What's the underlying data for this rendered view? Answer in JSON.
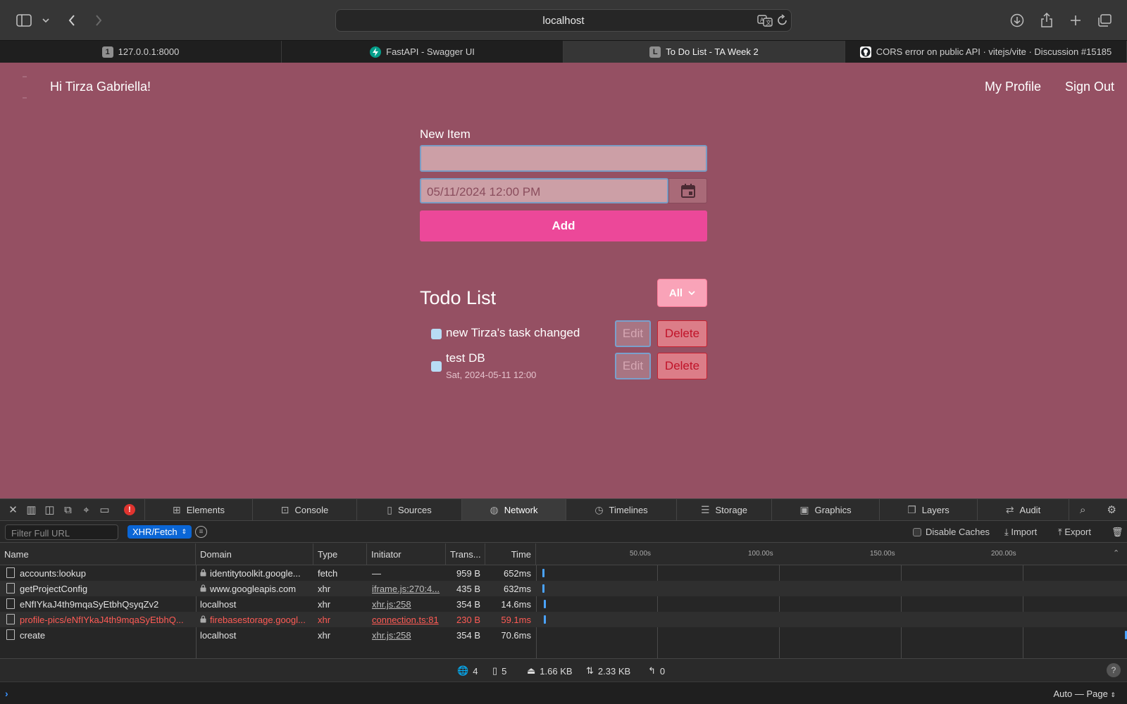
{
  "browser": {
    "url": "localhost",
    "tabs": [
      {
        "favicon": "1",
        "favicon_icon": "number-badge-icon",
        "label": "127.0.0.1:8000",
        "active": false
      },
      {
        "favicon": "",
        "favicon_icon": "fastapi-icon",
        "label": "FastAPI - Swagger UI",
        "active": false
      },
      {
        "favicon": "L",
        "favicon_icon": "letter-badge-icon",
        "label": "To Do List - TA Week 2",
        "active": true
      },
      {
        "favicon": "",
        "favicon_icon": "github-icon",
        "label": "CORS error on public API · vitejs/vite · Discussion #15185",
        "active": false
      }
    ]
  },
  "app": {
    "greeting": "Hi Tirza Gabriella!",
    "nav": {
      "profile": "My Profile",
      "signout": "Sign Out"
    },
    "form": {
      "label": "New Item",
      "item_value": "",
      "date_value": "05/11/2024 12:00 PM",
      "add_label": "Add"
    },
    "list": {
      "title": "Todo List",
      "filter": "All",
      "edit_label": "Edit",
      "delete_label": "Delete",
      "items": [
        {
          "text": "new Tirza's task changed",
          "date": ""
        },
        {
          "text": "test DB",
          "date": "Sat, 2024-05-11 12:00"
        }
      ]
    },
    "colors": {
      "background": "#955063",
      "accent": "#ec4899",
      "filter": "#f9a3b8"
    }
  },
  "devtools": {
    "tabs": [
      "Elements",
      "Console",
      "Sources",
      "Network",
      "Timelines",
      "Storage",
      "Graphics",
      "Layers",
      "Audit"
    ],
    "active_tab": "Network",
    "filter_placeholder": "Filter Full URL",
    "type_filter": "XHR/Fetch",
    "disable_caches": "Disable Caches",
    "import": "Import",
    "export": "Export",
    "columns": [
      "Name",
      "Domain",
      "Type",
      "Initiator",
      "Trans...",
      "Time"
    ],
    "timeline_ticks": [
      "50.00s",
      "100.00s",
      "150.00s",
      "200.00s"
    ],
    "rows": [
      {
        "name": "accounts:lookup",
        "domain": "identitytoolkit.google...",
        "secure": true,
        "type": "fetch",
        "initiator": "—",
        "initiator_link": false,
        "transferred": "959 B",
        "time": "652ms",
        "error": false
      },
      {
        "name": "getProjectConfig",
        "domain": "www.googleapis.com",
        "secure": true,
        "type": "xhr",
        "initiator": "iframe.js:270:4...",
        "initiator_link": true,
        "transferred": "435 B",
        "time": "632ms",
        "error": false
      },
      {
        "name": "eNfIYkaJ4th9mqaSyEtbhQsyqZv2",
        "domain": "localhost",
        "secure": false,
        "type": "xhr",
        "initiator": "xhr.js:258",
        "initiator_link": true,
        "transferred": "354 B",
        "time": "14.6ms",
        "error": false
      },
      {
        "name": "profile-pics/eNfIYkaJ4th9mqaSyEtbhQ...",
        "domain": "firebasestorage.googl...",
        "secure": true,
        "type": "xhr",
        "initiator": "connection.ts:81",
        "initiator_link": true,
        "transferred": "230 B",
        "time": "59.1ms",
        "error": true
      },
      {
        "name": "create",
        "domain": "localhost",
        "secure": false,
        "type": "xhr",
        "initiator": "xhr.js:258",
        "initiator_link": true,
        "transferred": "354 B",
        "time": "70.6ms",
        "error": false
      }
    ],
    "summary": {
      "domains": "4",
      "resources": "5",
      "size": "1.66 KB",
      "transferred": "2.33 KB",
      "redirects": "0"
    },
    "console_mode": "Auto — Page"
  }
}
